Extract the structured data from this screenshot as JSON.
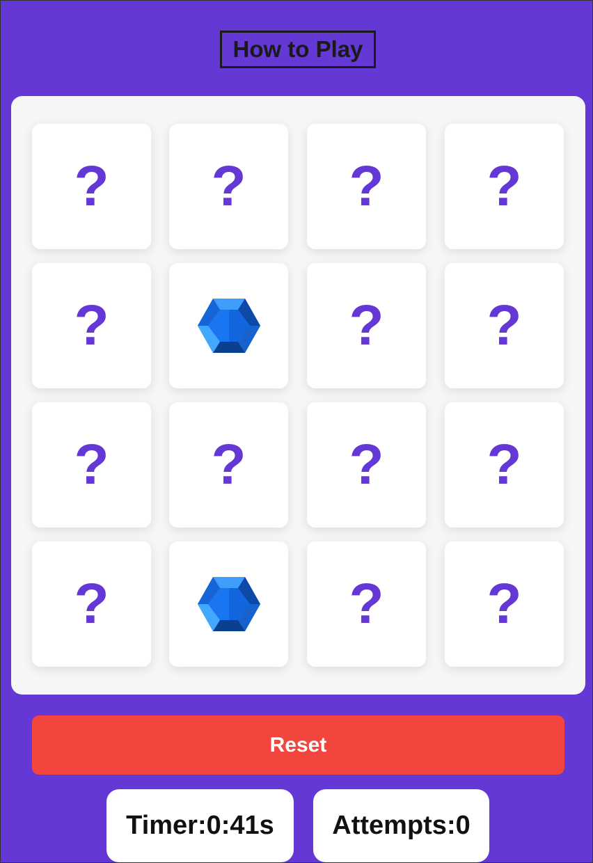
{
  "header": {
    "how_to_play_label": "How to Play"
  },
  "board": {
    "cards": [
      {
        "state": "hidden",
        "symbol": "?"
      },
      {
        "state": "hidden",
        "symbol": "?"
      },
      {
        "state": "hidden",
        "symbol": "?"
      },
      {
        "state": "hidden",
        "symbol": "?"
      },
      {
        "state": "hidden",
        "symbol": "?"
      },
      {
        "state": "revealed",
        "symbol": "blue-gem-icon"
      },
      {
        "state": "hidden",
        "symbol": "?"
      },
      {
        "state": "hidden",
        "symbol": "?"
      },
      {
        "state": "hidden",
        "symbol": "?"
      },
      {
        "state": "hidden",
        "symbol": "?"
      },
      {
        "state": "hidden",
        "symbol": "?"
      },
      {
        "state": "hidden",
        "symbol": "?"
      },
      {
        "state": "hidden",
        "symbol": "?"
      },
      {
        "state": "revealed",
        "symbol": "blue-gem-icon"
      },
      {
        "state": "hidden",
        "symbol": "?"
      },
      {
        "state": "hidden",
        "symbol": "?"
      }
    ]
  },
  "controls": {
    "reset_label": "Reset"
  },
  "stats": {
    "timer_text": "Timer:0:41s",
    "attempts_text": "Attempts:0"
  },
  "colors": {
    "background": "#6438d4",
    "board": "#f6f6f6",
    "question_mark": "#6438d4",
    "reset_button": "#f2453e"
  }
}
